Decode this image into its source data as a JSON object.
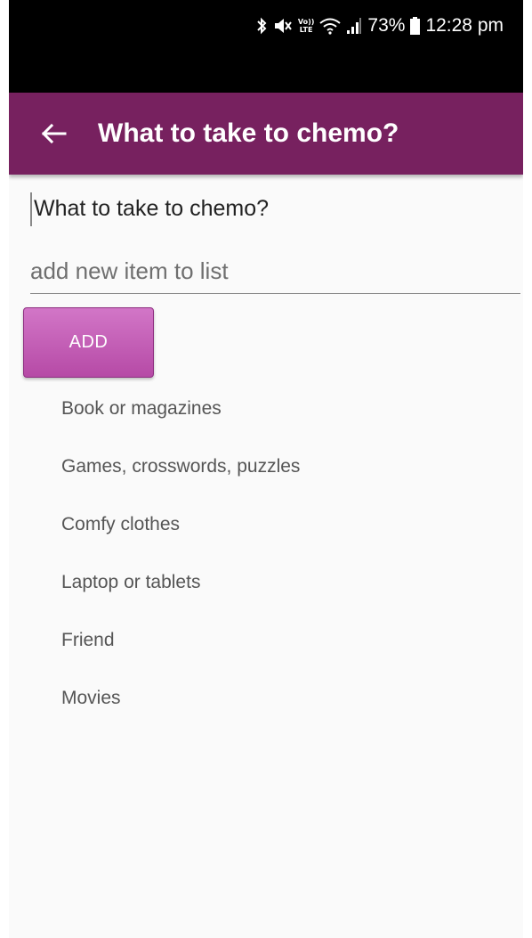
{
  "status_bar": {
    "battery": "73%",
    "time": "12:28 pm",
    "icons": [
      "bluetooth-icon",
      "mute-icon",
      "volte-lte-icon",
      "wifi-icon",
      "signal-icon",
      "battery-icon"
    ],
    "volte_top": "Vo))",
    "volte_bottom": "LTE"
  },
  "app_bar": {
    "title": "What to take to chemo?",
    "background": "#77215f",
    "back_icon": "arrow-left-icon"
  },
  "content": {
    "list_title": "What to take to chemo?",
    "input_placeholder": "add new item to list",
    "add_label": "ADD",
    "add_color": "#c15db3",
    "items": [
      "Book or magazines",
      "Games, crosswords, puzzles",
      "Comfy clothes",
      "Laptop or tablets",
      "Friend",
      "Movies"
    ]
  }
}
